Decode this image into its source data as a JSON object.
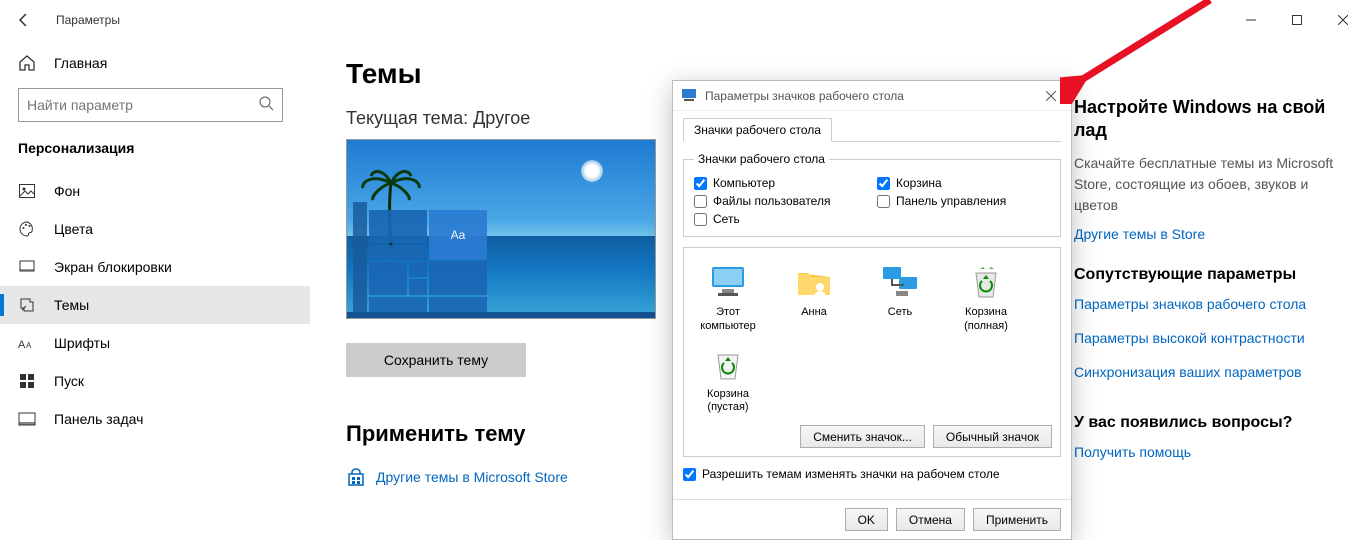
{
  "window": {
    "title": "Параметры"
  },
  "sidebar": {
    "home": "Главная",
    "search_placeholder": "Найти параметр",
    "category": "Персонализация",
    "items": [
      {
        "label": "Фон"
      },
      {
        "label": "Цвета"
      },
      {
        "label": "Экран блокировки"
      },
      {
        "label": "Темы"
      },
      {
        "label": "Шрифты"
      },
      {
        "label": "Пуск"
      },
      {
        "label": "Панель задач"
      }
    ]
  },
  "main": {
    "title": "Темы",
    "current_theme_label": "Текущая тема: Другое",
    "preview_tile_label": "Aa",
    "save_button": "Сохранить тему",
    "apply_title": "Применить тему",
    "store_link": "Другие темы в Microsoft Store"
  },
  "rail": {
    "custom_h": "Настройте Windows на свой лад",
    "custom_p": "Скачайте бесплатные темы из Microsoft Store, состоящие из обоев, звуков и цветов",
    "store_link": "Другие темы в Store",
    "related_h": "Сопутствующие параметры",
    "link_icons": "Параметры значков рабочего стола",
    "link_contrast": "Параметры высокой контрастности",
    "link_sync": "Синхронизация ваших параметров",
    "help_h": "У вас появились вопросы?",
    "help_link": "Получить помощь"
  },
  "dialog": {
    "title": "Параметры значков рабочего стола",
    "tab": "Значки рабочего стола",
    "legend": "Значки рабочего стола",
    "checks": {
      "computer": "Компьютер",
      "recycle": "Корзина",
      "user_files": "Файлы пользователя",
      "control_panel": "Панель управления",
      "network": "Сеть"
    },
    "states": {
      "computer": true,
      "recycle": true,
      "user_files": false,
      "control_panel": false,
      "network": false
    },
    "icons": {
      "this_pc": "Этот компьютер",
      "user": "Анна",
      "net": "Сеть",
      "bin_full": "Корзина (полная)",
      "bin_empty": "Корзина (пустая)"
    },
    "change_icon": "Сменить значок...",
    "default_icon": "Обычный значок",
    "allow_themes": "Разрешить темам изменять значки на рабочем столе",
    "allow_themes_state": true,
    "ok": "OK",
    "cancel": "Отмена",
    "apply": "Применить"
  }
}
